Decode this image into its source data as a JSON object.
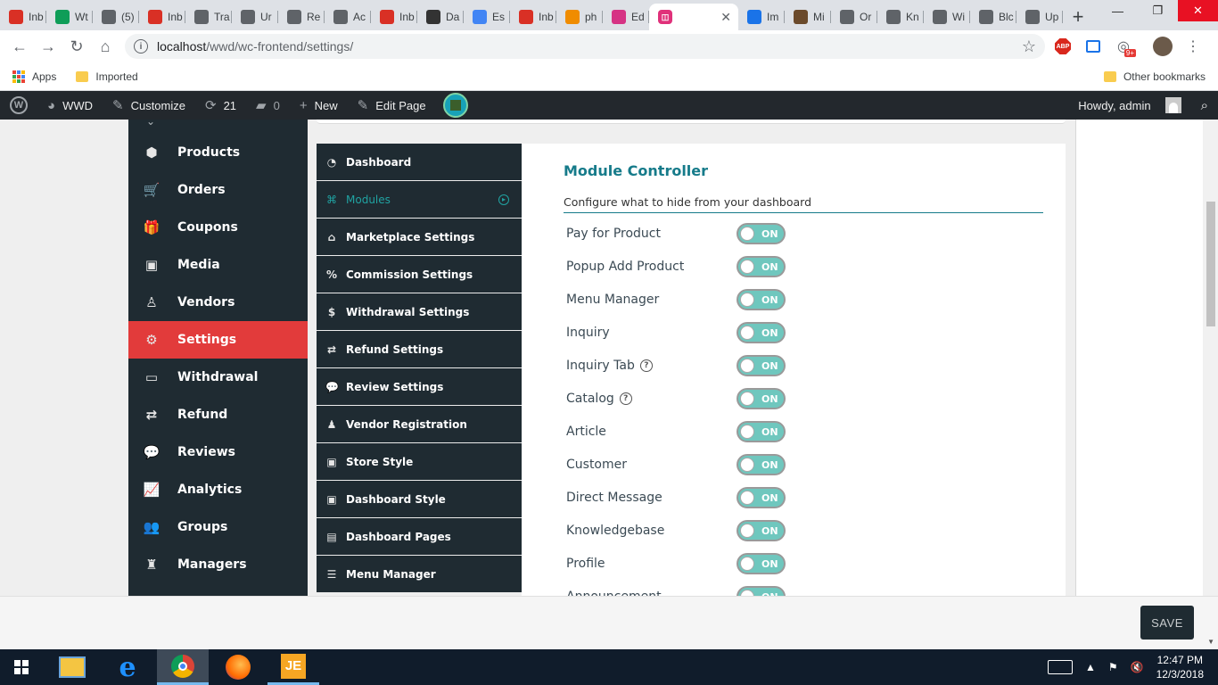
{
  "browser": {
    "tabs": [
      {
        "title": "Inb",
        "icon": "gmail-icon",
        "color": "#d93025"
      },
      {
        "title": "Wt",
        "icon": "sheets-icon",
        "color": "#0f9d58"
      },
      {
        "title": "(5)",
        "icon": "mail-icon",
        "color": "#5f6368"
      },
      {
        "title": "Inb",
        "icon": "gmail-icon",
        "color": "#d93025"
      },
      {
        "title": "Tra",
        "icon": "wp-icon",
        "color": "#5f6368"
      },
      {
        "title": "Ur",
        "icon": "wp-icon",
        "color": "#5f6368"
      },
      {
        "title": "Re",
        "icon": "wp-icon",
        "color": "#5f6368"
      },
      {
        "title": "Ac",
        "icon": "wp-icon",
        "color": "#5f6368"
      },
      {
        "title": "Inb",
        "icon": "gmail-icon",
        "color": "#d93025"
      },
      {
        "title": "Da",
        "icon": "cursor-icon",
        "color": "#333333"
      },
      {
        "title": "Es",
        "icon": "doc-icon",
        "color": "#4285f4"
      },
      {
        "title": "Inb",
        "icon": "gmail-icon",
        "color": "#d93025"
      },
      {
        "title": "ph",
        "icon": "vlc-icon",
        "color": "#f08c00"
      },
      {
        "title": "Ed",
        "icon": "plugin-icon",
        "color": "#d63384"
      }
    ],
    "active_tab": {
      "title": "",
      "icon": "wcfm-icon",
      "color": "#e0317a"
    },
    "tabs_after": [
      {
        "title": "Im",
        "icon": "ibb-icon",
        "color": "#1a73e8"
      },
      {
        "title": "Mi",
        "icon": "grid-icon",
        "color": "#6b4a2b"
      },
      {
        "title": "Or",
        "icon": "wp-icon",
        "color": "#5f6368"
      },
      {
        "title": "Kn",
        "icon": "wp-icon",
        "color": "#5f6368"
      },
      {
        "title": "Wi",
        "icon": "wp-icon",
        "color": "#5f6368"
      },
      {
        "title": "Blc",
        "icon": "wp-icon",
        "color": "#5f6368"
      },
      {
        "title": "Up",
        "icon": "upload-icon",
        "color": "#5f6368"
      }
    ],
    "url_host": "localhost",
    "url_path": "/wwd/wc-frontend/settings/",
    "bookmarks": {
      "apps": "Apps",
      "imported": "Imported",
      "other": "Other bookmarks"
    },
    "ext_badge": "9+",
    "abp": "ABP"
  },
  "adminbar": {
    "site": "WWD",
    "customize": "Customize",
    "updates": "21",
    "comments": "0",
    "new": "New",
    "edit_page": "Edit Page",
    "howdy": "Howdy, admin"
  },
  "sidebar": {
    "items": [
      {
        "label": "Products",
        "icon": "cubes-icon",
        "glyph": "⬢"
      },
      {
        "label": "Orders",
        "icon": "cart-icon",
        "glyph": "🛒"
      },
      {
        "label": "Coupons",
        "icon": "gift-icon",
        "glyph": "🎁"
      },
      {
        "label": "Media",
        "icon": "image-icon",
        "glyph": "▣"
      },
      {
        "label": "Vendors",
        "icon": "user-icon",
        "glyph": "♙"
      },
      {
        "label": "Settings",
        "icon": "cogs-icon",
        "glyph": "⚙"
      },
      {
        "label": "Withdrawal",
        "icon": "card-icon",
        "glyph": "▭"
      },
      {
        "label": "Refund",
        "icon": "exchange-icon",
        "glyph": "⇄"
      },
      {
        "label": "Reviews",
        "icon": "comments-icon",
        "glyph": "💬"
      },
      {
        "label": "Analytics",
        "icon": "chart-icon",
        "glyph": "📈"
      },
      {
        "label": "Groups",
        "icon": "users-icon",
        "glyph": "👥"
      },
      {
        "label": "Managers",
        "icon": "manager-icon",
        "glyph": "♜"
      }
    ],
    "active": "Settings"
  },
  "settings_menu": {
    "items": [
      {
        "label": "Dashboard",
        "icon": "dashboard-icon",
        "glyph": "◔"
      },
      {
        "label": "Modules",
        "icon": "modules-icon",
        "glyph": "⌘"
      },
      {
        "label": "Marketplace Settings",
        "icon": "home-icon",
        "glyph": "⌂"
      },
      {
        "label": "Commission Settings",
        "icon": "percent-icon",
        "glyph": "%"
      },
      {
        "label": "Withdrawal Settings",
        "icon": "dollar-icon",
        "glyph": "$"
      },
      {
        "label": "Refund Settings",
        "icon": "exchange-icon",
        "glyph": "⇄"
      },
      {
        "label": "Review Settings",
        "icon": "comments-icon",
        "glyph": "💬"
      },
      {
        "label": "Vendor Registration",
        "icon": "user-icon",
        "glyph": "♟"
      },
      {
        "label": "Store Style",
        "icon": "image-icon",
        "glyph": "▣"
      },
      {
        "label": "Dashboard Style",
        "icon": "image-icon",
        "glyph": "▣"
      },
      {
        "label": "Dashboard Pages",
        "icon": "pages-icon",
        "glyph": "▤"
      },
      {
        "label": "Menu Manager",
        "icon": "list-icon",
        "glyph": "☰"
      }
    ],
    "active": "Modules"
  },
  "module_controller": {
    "title": "Module Controller",
    "description": "Configure what to hide from your dashboard",
    "toggle_label": "ON",
    "modules": [
      {
        "label": "Pay for Product",
        "help": false,
        "on": true
      },
      {
        "label": "Popup Add Product",
        "help": false,
        "on": true
      },
      {
        "label": "Menu Manager",
        "help": false,
        "on": true
      },
      {
        "label": "Inquiry",
        "help": false,
        "on": true
      },
      {
        "label": "Inquiry Tab",
        "help": true,
        "on": true
      },
      {
        "label": "Catalog",
        "help": true,
        "on": true
      },
      {
        "label": "Article",
        "help": false,
        "on": true
      },
      {
        "label": "Customer",
        "help": false,
        "on": true
      },
      {
        "label": "Direct Message",
        "help": false,
        "on": true
      },
      {
        "label": "Knowledgebase",
        "help": false,
        "on": true
      },
      {
        "label": "Profile",
        "help": false,
        "on": true
      },
      {
        "label": "Announcement",
        "help": false,
        "on": true
      }
    ]
  },
  "save_button": "SAVE",
  "taskbar": {
    "time": "12:47 PM",
    "date": "12/3/2018"
  },
  "colors": {
    "accent": "#e23b3b",
    "teal": "#167b8a",
    "nav_bg": "#1f2b32",
    "toggle_on": "#6fc7be"
  }
}
